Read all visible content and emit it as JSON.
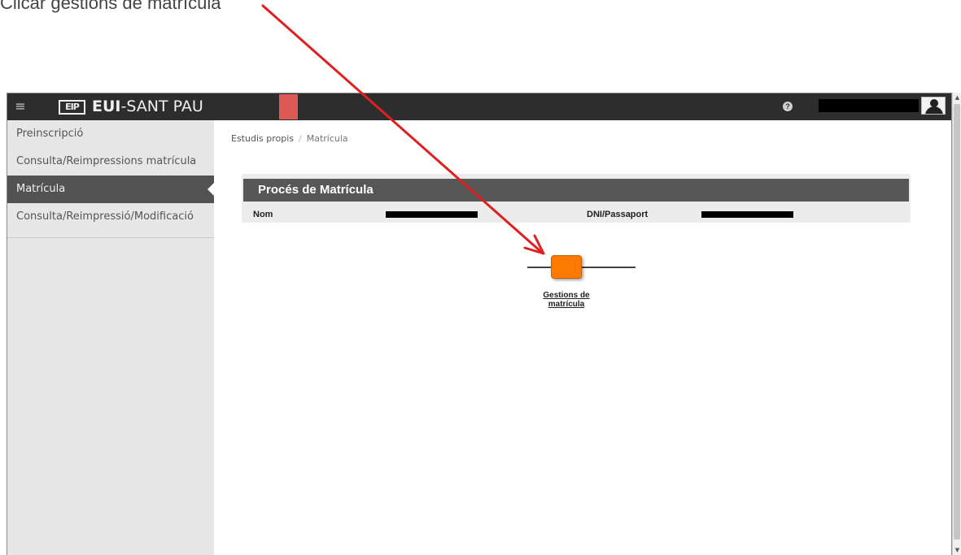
{
  "instruction": "Clicar gestions de matrícula",
  "topbar": {
    "menu_icon": "hamburger-menu-icon",
    "logo_text": "EIP",
    "brand_bold": "EUI",
    "brand_rest": "-SANT PAU",
    "help_icon": "?",
    "accent_color": "#dc5a55"
  },
  "sidebar": {
    "items": [
      {
        "label": "Preinscripció"
      },
      {
        "label": "Consulta/Reimpressions matrícula"
      },
      {
        "label": "Matrícula"
      },
      {
        "label": "Consulta/Reimpressió/Modificació"
      }
    ],
    "active_index": 2
  },
  "breadcrumb": {
    "root": "Estudis propis",
    "separator": "/",
    "current": "Matrícula"
  },
  "process": {
    "title": "Procés de Matrícula",
    "name_label": "Nom",
    "id_label": "DNI/Passaport"
  },
  "steps": [
    {
      "label": "Gestions de matrícula",
      "color": "#ff7a00"
    }
  ],
  "annotation": {
    "arrow_color": "#e02020"
  }
}
